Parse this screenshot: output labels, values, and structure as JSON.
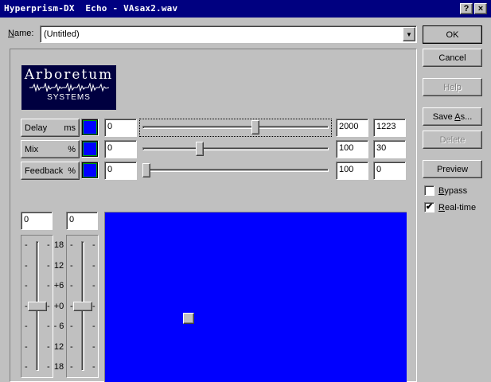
{
  "window": {
    "title": "Hyperprism-DX  Echo - VAsax2.wav",
    "help_glyph": "?",
    "close_glyph": "×"
  },
  "name": {
    "label_prefix": "N",
    "label_rest": "ame:",
    "value": "(Untitled)",
    "dropdown_glyph": "▼"
  },
  "logo": {
    "line1": "Arboretum",
    "wave": "ᴧᴧ𝗐ᴧᴧ𝗐ᴧᴧᴧᴧ𝗐ᴧᴧ",
    "line2": "SYSTEMS"
  },
  "params": [
    {
      "name": "Delay",
      "unit": "ms",
      "min": "0",
      "max": "2000",
      "value": "1223",
      "fraction": 0.6115
    },
    {
      "name": "Mix",
      "unit": "%",
      "min": "0",
      "max": "100",
      "value": "30",
      "fraction": 0.3
    },
    {
      "name": "Feedback",
      "unit": "%",
      "min": "0",
      "max": "100",
      "value": "0",
      "fraction": 0.0
    }
  ],
  "buttons": {
    "ok": "OK",
    "cancel": "Cancel",
    "help": "Help",
    "save_as_prefix": "Save ",
    "save_as_u": "A",
    "save_as_rest": "s...",
    "delete": "Delete",
    "preview": "Preview"
  },
  "checkboxes": {
    "bypass_u": "B",
    "bypass_rest": "ypass",
    "bypass_checked": false,
    "realtime_u": "R",
    "realtime_rest": "eal-time",
    "realtime_checked": true,
    "check_glyph": "✔"
  },
  "level": {
    "left_value": "0",
    "right_value": "0",
    "scale": [
      "18",
      "12",
      "+6",
      "+0",
      "- 6",
      "12",
      "18"
    ],
    "left_fraction": 0.5,
    "right_fraction": 0.5
  },
  "pad": {
    "color": "#0000ff",
    "point_x_fraction": 0.275,
    "point_y_fraction": 0.62
  }
}
